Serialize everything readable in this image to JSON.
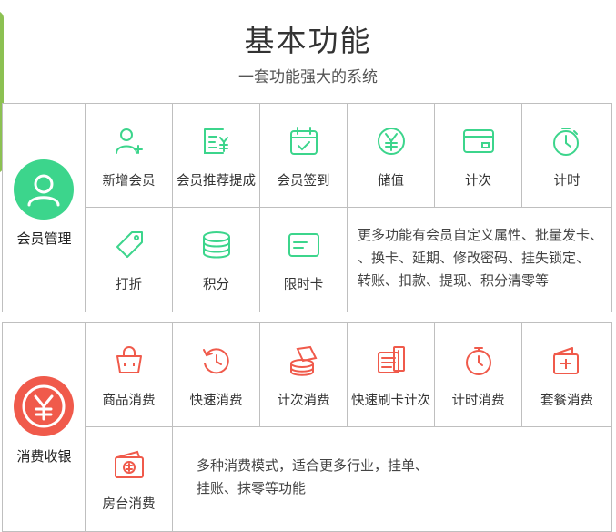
{
  "header": {
    "title": "基本功能",
    "subtitle": "一套功能强大的系统"
  },
  "colors": {
    "member_green": "#3cd58c",
    "consume_red": "#f05a4b",
    "side_tab": "#8cc152"
  },
  "member": {
    "label": "会员管理",
    "icon": "user-icon",
    "items": [
      {
        "label": "新增会员",
        "icon": "add-user-icon"
      },
      {
        "label": "会员推荐提成",
        "icon": "commission-receipt-icon"
      },
      {
        "label": "会员签到",
        "icon": "calendar-check-icon"
      },
      {
        "label": "储值",
        "icon": "yen-coin-icon"
      },
      {
        "label": "计次",
        "icon": "card-icon"
      },
      {
        "label": "计时",
        "icon": "stopwatch-icon"
      },
      {
        "label": "打折",
        "icon": "tag-icon"
      },
      {
        "label": "积分",
        "icon": "coin-stack-icon"
      },
      {
        "label": "限时卡",
        "icon": "time-card-icon"
      }
    ],
    "description": "更多功能有会员自定义属性、批量发卡、换卡、延期、修改密码、挂失锁定、转账、扣款、提现、积分清零等",
    "description_lines": [
      "更多功能有会员自定义属性、批量发卡、",
      "、换卡、延期、修改密码、挂失锁定、",
      "转账、扣款、提现、积分清零等"
    ]
  },
  "consume": {
    "label": "消费收银",
    "icon": "yen-cashier-icon",
    "items": [
      {
        "label": "商品消费",
        "icon": "shopping-basket-icon"
      },
      {
        "label": "快速消费",
        "icon": "history-icon"
      },
      {
        "label": "计次消费",
        "icon": "coins-icon"
      },
      {
        "label": "快速刷卡计次",
        "icon": "card-swipe-icon"
      },
      {
        "label": "计时消费",
        "icon": "timer-icon"
      },
      {
        "label": "套餐消费",
        "icon": "package-icon"
      },
      {
        "label": "房台消费",
        "icon": "money-bill-icon"
      }
    ],
    "description_lines": [
      "多种消费模式，适合更多行业，挂单、",
      "挂账、抹零等功能"
    ]
  }
}
